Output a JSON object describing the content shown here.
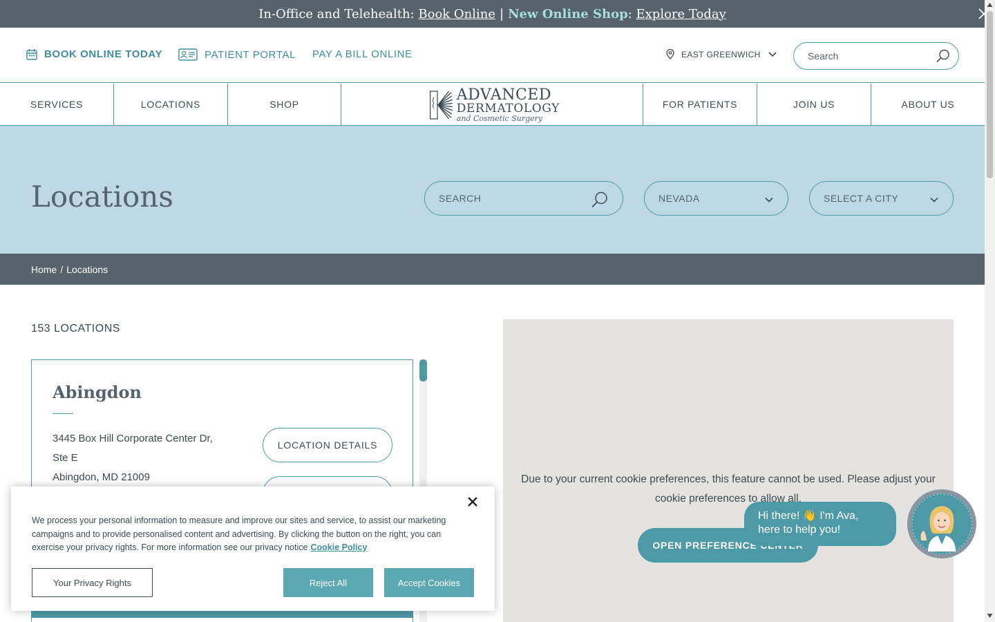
{
  "announcement": {
    "prefix": "In-Office and Telehealth:",
    "book_link": "Book Online",
    "separator": "|",
    "highlight": "New Online Shop",
    "colon": ":",
    "explore_link": "Explore Today"
  },
  "utility": {
    "book": "BOOK ONLINE TODAY",
    "portal": "PATIENT PORTAL",
    "bill": "PAY A BILL ONLINE",
    "location": "EAST GREENWICH",
    "search_placeholder": "Search"
  },
  "nav": {
    "services": "SERVICES",
    "locations": "LOCATIONS",
    "shop": "SHOP",
    "for_patients": "FOR PATIENTS",
    "join_us": "JOIN US",
    "about_us": "ABOUT US"
  },
  "logo": {
    "line1": "ADVANCED",
    "line2": "DERMATOLOGY",
    "line3": "and Cosmetic Surgery"
  },
  "hero": {
    "title": "Locations",
    "search_placeholder": "SEARCH",
    "state": "NEVADA",
    "city": "SELECT A CITY"
  },
  "breadcrumb": {
    "home": "Home",
    "sep": "/",
    "current": "Locations"
  },
  "listing": {
    "count": "153 LOCATIONS",
    "card": {
      "name": "Abingdon",
      "address_line1": "3445 Box Hill Corporate Center Dr,",
      "address_line2": "Ste E",
      "address_line3": "Abingdon, MD 21009",
      "details_btn": "LOCATION DETAILS"
    }
  },
  "map": {
    "message": "Due to your current cookie preferences, this feature cannot be used. Please adjust your cookie preferences to allow all.",
    "button": "OPEN PREFERENCE CENTER"
  },
  "chat": {
    "line1": "Hi there! 👋 I'm Ava,",
    "line2": "here to help you!"
  },
  "cookie": {
    "text": "We process your personal information to measure and improve our sites and service, to assist our marketing campaigns and to provide personalised content and advertising. By clicking the button on the right, you can exercise your privacy rights. For more information see our privacy notice",
    "link": "Cookie Policy",
    "rights": "Your Privacy Rights",
    "reject": "Reject All",
    "accept": "Accept Cookies"
  },
  "colors": {
    "teal": "#4d9aa6",
    "slate": "#56636c",
    "hero_bg": "#bed8e6",
    "map_bg": "#e5e3df",
    "cookie_btn": "#5ba8b3"
  },
  "icons": [
    "calendar-icon",
    "id-card-icon",
    "map-pin-icon",
    "chevron-down-icon",
    "search-icon",
    "close-icon",
    "avatar-icon"
  ]
}
